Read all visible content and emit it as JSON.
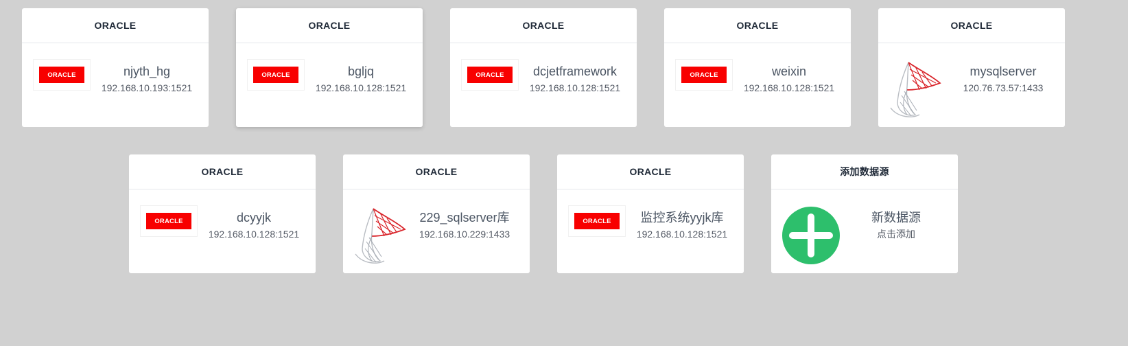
{
  "cards": [
    {
      "header": "ORACLE",
      "logo": "oracle-logo",
      "logo_text": "ORACLE",
      "name": "njyth_hg",
      "address": "192.168.10.193:1521"
    },
    {
      "header": "ORACLE",
      "logo": "oracle-logo",
      "logo_text": "ORACLE",
      "name": "bgljq",
      "address": "192.168.10.128:1521"
    },
    {
      "header": "ORACLE",
      "logo": "oracle-logo",
      "logo_text": "ORACLE",
      "name": "dcjetframework",
      "address": "192.168.10.128:1521"
    },
    {
      "header": "ORACLE",
      "logo": "oracle-logo",
      "logo_text": "ORACLE",
      "name": "weixin",
      "address": "192.168.10.128:1521"
    },
    {
      "header": "ORACLE",
      "logo": "sqlserver-logo",
      "name": "mysqlserver",
      "address": "120.76.73.57:1433"
    },
    {
      "header": "ORACLE",
      "logo": "oracle-logo",
      "logo_text": "ORACLE",
      "name": "dcyyjk",
      "address": "192.168.10.128:1521"
    },
    {
      "header": "ORACLE",
      "logo": "sqlserver-logo",
      "name": "229_sqlserver库",
      "address": "192.168.10.229:1433"
    },
    {
      "header": "ORACLE",
      "logo": "oracle-logo",
      "logo_text": "ORACLE",
      "name": "监控系统yyjk库",
      "address": "192.168.10.128:1521"
    },
    {
      "header": "添加数据源",
      "logo": "add-icon",
      "name": "新数据源",
      "address": "点击添加"
    }
  ],
  "colors": {
    "page_background": "#d1d1d1",
    "card_background": "#ffffff",
    "oracle_red": "#f80000",
    "add_green": "#2dbf6c",
    "sqlserver_red": "#d9252b"
  }
}
